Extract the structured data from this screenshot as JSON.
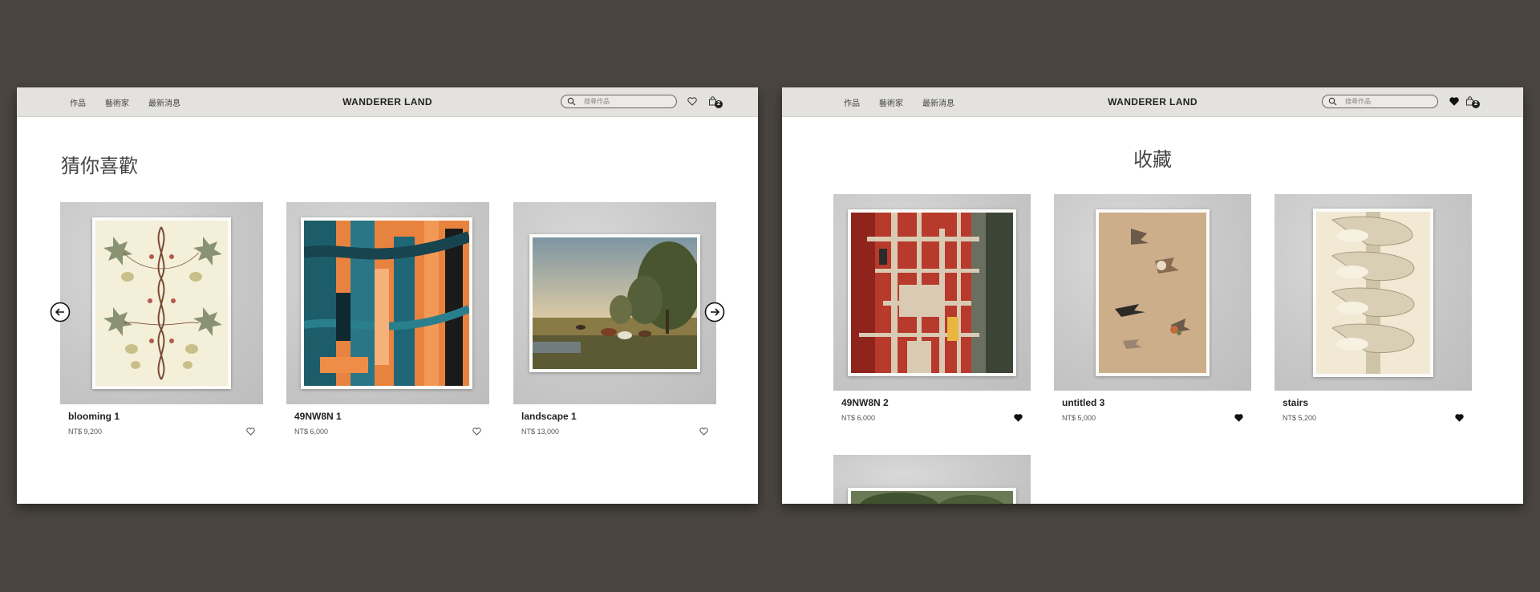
{
  "colors": {
    "backdrop": "#4a4540",
    "navbar": "#e3e2df",
    "text": "#222222",
    "badge": "#222222"
  },
  "left_window": {
    "nav": [
      "作品",
      "藝術家",
      "最新消息"
    ],
    "brand": "WANDERER LAND",
    "search": {
      "placeholder": "搜尋作品",
      "value": ""
    },
    "cart_count": "2",
    "heading": "猜你喜歡",
    "products": [
      {
        "title": "blooming 1",
        "price": "NT$ 9,200",
        "favorited": false,
        "art": "botanical-print"
      },
      {
        "title": "49NW8N 1",
        "price": "NT$ 6,000",
        "favorited": false,
        "art": "abstract-teal-orange"
      },
      {
        "title": "landscape 1",
        "price": "NT$ 13,000",
        "favorited": false,
        "art": "pastoral-landscape"
      }
    ],
    "icons": {
      "prev": "arrow-left-circle-icon",
      "next": "arrow-right-circle-icon",
      "search": "search-icon",
      "heart": "heart-icon",
      "cart": "cart-icon"
    }
  },
  "right_window": {
    "nav": [
      "作品",
      "藝術家",
      "最新消息"
    ],
    "brand": "WANDERER LAND",
    "search": {
      "placeholder": "搜尋作品",
      "value": ""
    },
    "cart_count": "2",
    "heading": "收藏",
    "products": [
      {
        "title": "49NW8N 2",
        "price": "NT$ 6,000",
        "favorited": true,
        "art": "abstract-red-grid"
      },
      {
        "title": "untitled 3",
        "price": "NT$ 5,000",
        "favorited": true,
        "art": "birds-sketch"
      },
      {
        "title": "stairs",
        "price": "NT$ 5,200",
        "favorited": true,
        "art": "spiral-stairs"
      }
    ],
    "icons": {
      "search": "search-icon",
      "heart": "heart-filled-icon",
      "cart": "cart-icon"
    }
  }
}
